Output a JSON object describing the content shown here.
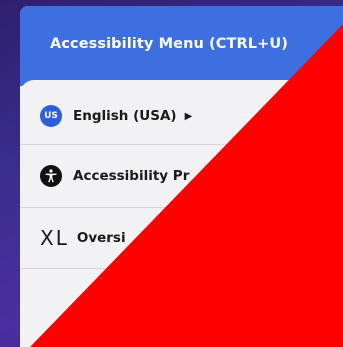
{
  "menu": {
    "title": "Accessibility Menu (CTRL+U)",
    "items": [
      {
        "icon": "us-flag-badge-icon",
        "badge_text": "US",
        "label": "English (USA)",
        "has_submenu": true
      },
      {
        "icon": "accessibility-person-icon",
        "label": "Accessibility Pr"
      },
      {
        "icon": "xl-text-size-icon",
        "icon_text": "XL",
        "label": "Oversi"
      }
    ]
  },
  "colors": {
    "header": "#3d6fe0",
    "overlay": "#ff0000",
    "background": "#3a2d8c"
  }
}
